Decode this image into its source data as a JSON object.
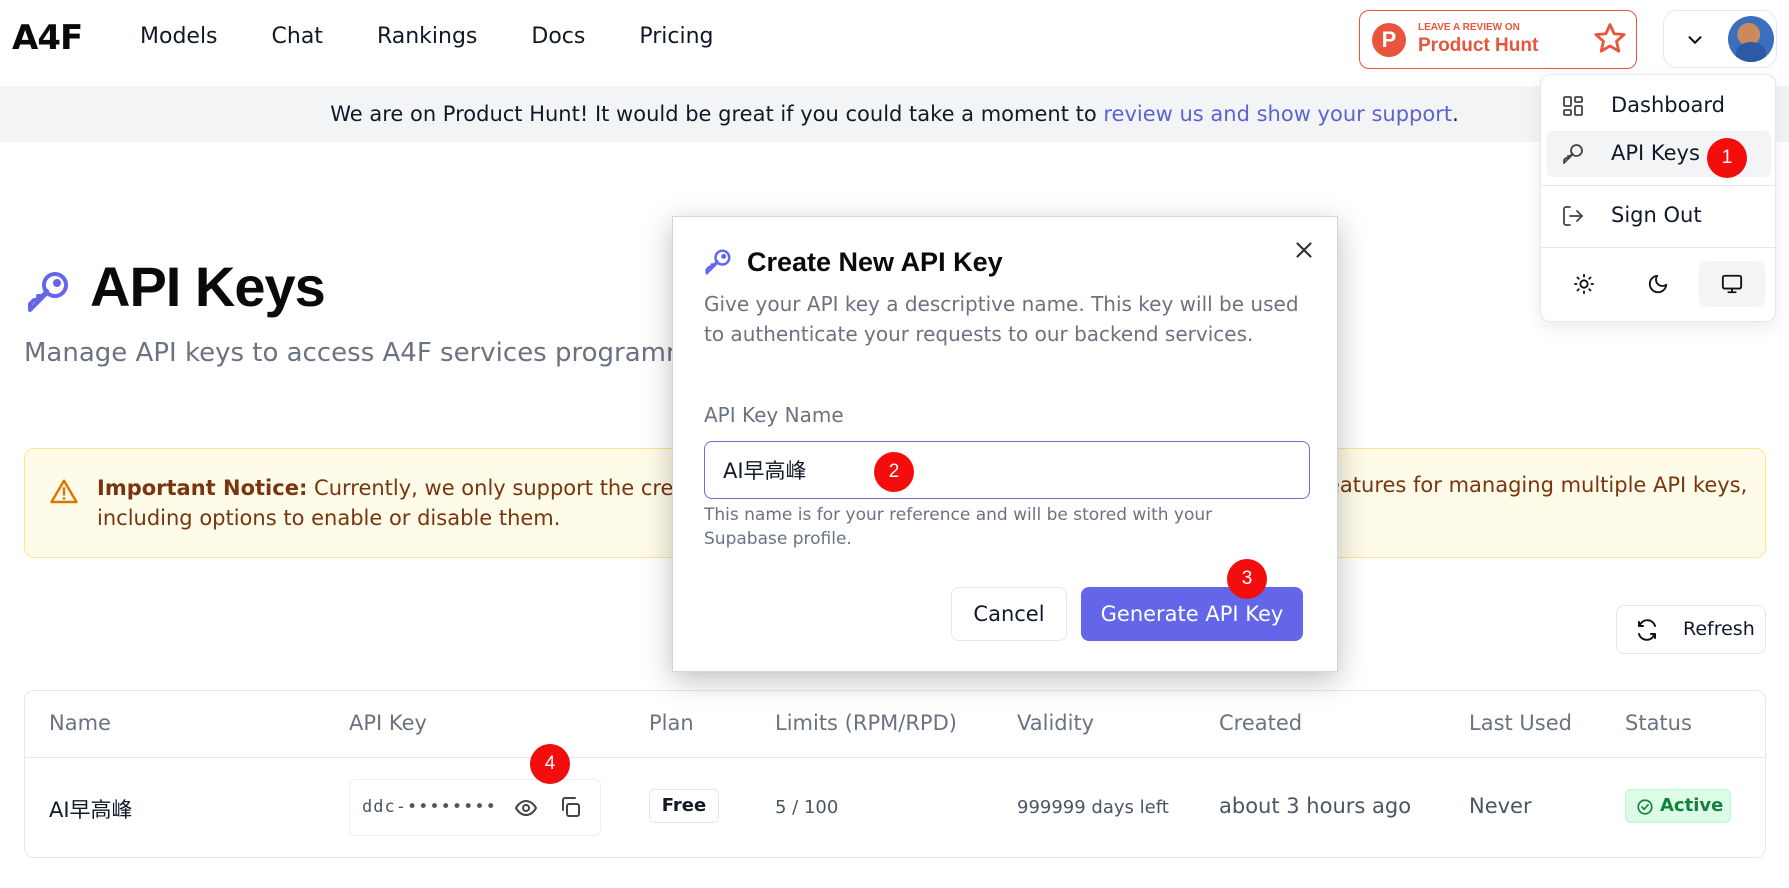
{
  "header": {
    "logo": "A4F",
    "nav": [
      "Models",
      "Chat",
      "Rankings",
      "Docs",
      "Pricing"
    ],
    "product_hunt": {
      "small": "LEAVE A REVIEW ON",
      "big": "Product Hunt",
      "logo_letter": "P"
    }
  },
  "banner": {
    "text": "We are on Product Hunt! It would be great if you could take a moment to ",
    "link": "review us and show your support",
    "suffix": "."
  },
  "page": {
    "title": "API Keys",
    "subtitle": "Manage API keys to access A4F services programm"
  },
  "notice": {
    "bold": "Important Notice:",
    "text": " Currently, we only support the creatio",
    "line2": "including options to enable or disable them.",
    "right": "eatures for managing multiple API keys,"
  },
  "refresh": {
    "label": "Refresh"
  },
  "table": {
    "headers": [
      "Name",
      "API Key",
      "Plan",
      "Limits (RPM/RPD)",
      "Validity",
      "Created",
      "Last Used",
      "Status"
    ],
    "row": {
      "name": "AI早高峰",
      "key": "ddc-••••••••",
      "plan": "Free",
      "limits": "5 / 100",
      "validity": "999999 days left",
      "created": "about 3 hours ago",
      "last_used": "Never",
      "status": "Active"
    }
  },
  "menu": {
    "items": [
      "Dashboard",
      "API Keys",
      "Sign Out"
    ]
  },
  "modal": {
    "title": "Create New API Key",
    "description": "Give your API key a descriptive name. This key will be used to authenticate your requests to our backend services.",
    "label": "API Key Name",
    "input_value": "AI早高峰",
    "help": "This name is for your reference and will be stored with your Supabase profile.",
    "cancel": "Cancel",
    "generate": "Generate API Key"
  },
  "markers": [
    "1",
    "2",
    "3",
    "4"
  ],
  "colors": {
    "accent": "#6366e9",
    "link": "#5b63d3",
    "product_hunt": "#e8553b",
    "marker": "#f40d0d",
    "status_active": "#15803d"
  }
}
